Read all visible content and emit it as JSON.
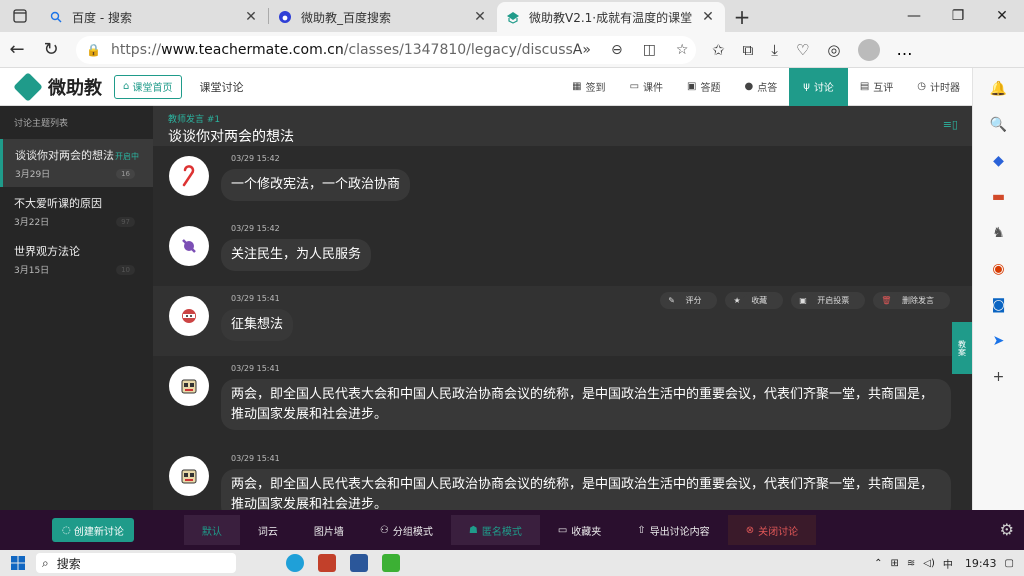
{
  "browser": {
    "tabs": [
      {
        "label": "百度 - 搜索",
        "icon": "search-icon"
      },
      {
        "label": "微助教_百度搜索",
        "icon": "baidu-icon"
      },
      {
        "label": "微助教V2.1·成就有温度的课堂",
        "icon": "teachermate-icon",
        "active": true
      }
    ],
    "url_prefix": "https://",
    "url_host": "www.teachermate.com.cn",
    "url_path": "/classes/1347810/legacy/discuss"
  },
  "app": {
    "logo_text": "微助教",
    "home_button": "课堂首页",
    "breadcrumb": "课堂讨论",
    "nav": [
      {
        "label": "签到",
        "icon": "calendar-icon"
      },
      {
        "label": "课件",
        "icon": "slides-icon"
      },
      {
        "label": "答题",
        "icon": "quiz-icon"
      },
      {
        "label": "点答",
        "icon": "check-icon"
      },
      {
        "label": "讨论",
        "icon": "discuss-icon",
        "active": true
      },
      {
        "label": "互评",
        "icon": "review-icon"
      },
      {
        "label": "计时器",
        "icon": "timer-icon"
      }
    ],
    "accent_color": "#1f9b8a"
  },
  "sidebar": {
    "title": "讨论主题列表",
    "topics": [
      {
        "title": "谈谈你对两会的想法",
        "date": "3月29日",
        "status": "开启中",
        "count": "16"
      },
      {
        "title": "不大爱听课的原因",
        "date": "3月22日",
        "count": "97"
      },
      {
        "title": "世界观方法论",
        "date": "3月15日",
        "count": "10"
      }
    ]
  },
  "discussion": {
    "label": "教师发言 #1",
    "title": "谈谈你对两会的想法",
    "messages": [
      {
        "time": "03/29 15:42",
        "text": "一个修改宪法，一个政治协商",
        "avatar": "candy-cane-icon"
      },
      {
        "time": "03/29 15:42",
        "text": "关注民生，为人民服务",
        "avatar": "candy-icon"
      },
      {
        "time": "03/29 15:41",
        "text": "征集想法",
        "avatar": "ninja-icon"
      },
      {
        "time": "03/29 15:41",
        "text": "两会，即全国人民代表大会和中国人民政治协商会议的统称，是中国政治生活中的重要会议，代表们齐聚一堂，共商国是，推动国家发展和社会进步。",
        "avatar": "robot-icon"
      },
      {
        "time": "03/29 15:41",
        "text": "两会，即全国人民代表大会和中国人民政治协商会议的统称，是中国政治生活中的重要会议，代表们齐聚一堂，共商国是，推动国家发展和社会进步。",
        "avatar": "robot-icon"
      }
    ],
    "actions": {
      "rate": "评分",
      "favorite": "收藏",
      "vote": "开启投票",
      "delete": "删除发言"
    },
    "side_tab": "教案"
  },
  "bottom_toolbar": {
    "create": "创建新讨论",
    "items": [
      {
        "label": "默认"
      },
      {
        "label": "词云"
      },
      {
        "label": "图片墙"
      },
      {
        "label": "分组模式"
      },
      {
        "label": "匿名模式"
      },
      {
        "label": "收藏夹"
      },
      {
        "label": "导出讨论内容"
      },
      {
        "label": "关闭讨论"
      }
    ]
  },
  "taskbar": {
    "search": "搜索",
    "time": "19:43"
  }
}
